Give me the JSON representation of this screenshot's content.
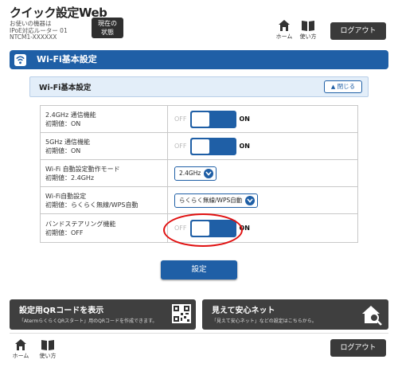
{
  "header": {
    "title": "クイック設定Web",
    "device_lines": [
      "お使いの機器は",
      "IPoE対応ルーター 01",
      "NTCM1-XXXXXX"
    ],
    "status_button_lines": [
      "現在の",
      "状態"
    ],
    "home_label": "ホーム",
    "manual_label": "使い方",
    "logout_label": "ログアウト"
  },
  "section": {
    "title": "Wi-Fi基本設定"
  },
  "panel": {
    "title": "Wi-Fi基本設定",
    "close_label": "閉じる"
  },
  "settings": [
    {
      "label": "2.4GHz 通信機能",
      "default": "初期値：ON",
      "control": "toggle",
      "off_label": "OFF",
      "on_label": "ON"
    },
    {
      "label": "5GHz 通信機能",
      "default": "初期値：ON",
      "control": "toggle",
      "off_label": "OFF",
      "on_label": "ON"
    },
    {
      "label": "Wi-Fi 自動設定動作モード",
      "default": "初期値：2.4GHz",
      "control": "select",
      "value": "2.4GHz"
    },
    {
      "label": "Wi-Fi自動設定",
      "default": "初期値：らくらく無線/WPS自動",
      "control": "select",
      "value": "らくらく無線/WPS自動"
    },
    {
      "label": "バンドステアリング機能",
      "default": "初期値：OFF",
      "control": "toggle",
      "off_label": "OFF",
      "on_label": "ON"
    }
  ],
  "apply_label": "設定",
  "cards": {
    "qr": {
      "title": "設定用QRコードを表示",
      "subtitle": "「AtermらくらくQRスタート」用のQRコードを作成できます。"
    },
    "safety": {
      "title": "見えて安心ネット",
      "subtitle": "「見えて安心ネット」などの設定はこちらから。"
    }
  },
  "footer": {
    "home_label": "ホーム",
    "manual_label": "使い方",
    "logout_label": "ログアウト"
  },
  "colors": {
    "accent": "#1f5fa6",
    "highlight": "#e01010",
    "dark": "#3f3f3f"
  }
}
